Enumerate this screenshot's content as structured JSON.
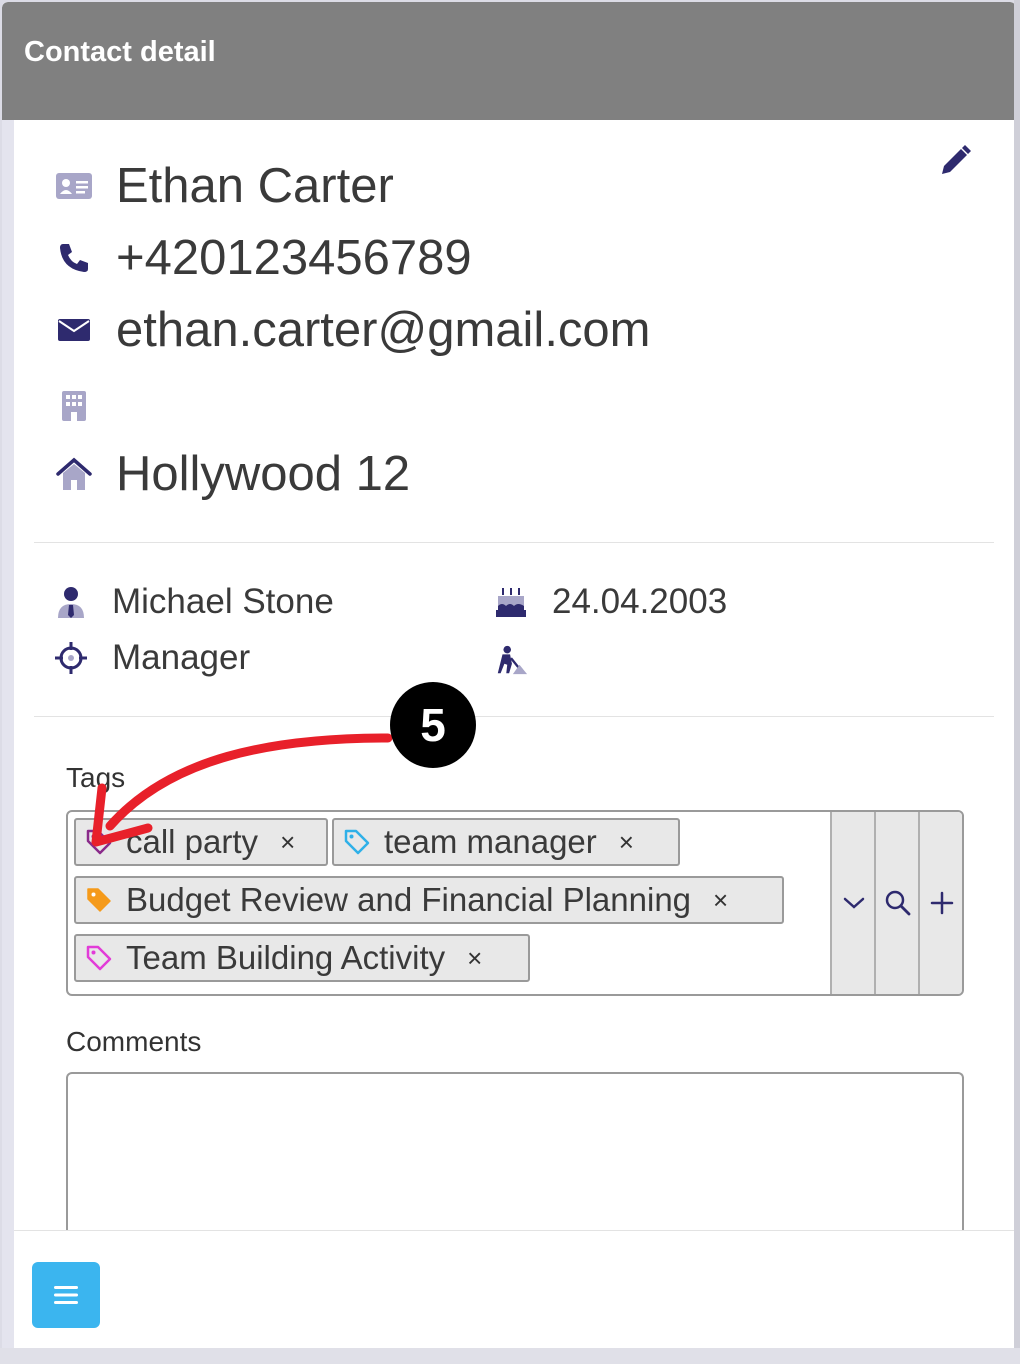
{
  "window": {
    "title": "Contact detail"
  },
  "contact": {
    "name": "Ethan Carter",
    "phone": "+420123456789",
    "email": "ethan.carter@gmail.com",
    "company": "",
    "address": "Hollywood 12"
  },
  "details": {
    "owner": "Michael Stone",
    "birthday": "24.04.2003",
    "position": "Manager",
    "occupation": ""
  },
  "tags": {
    "label": "Tags",
    "items": [
      {
        "text": "call party",
        "color": "#8a2a8a"
      },
      {
        "text": "team manager",
        "color": "#2fb0e8"
      },
      {
        "text": "Budget Review and Financial Planning",
        "color": "#f59a1a"
      },
      {
        "text": "Team Building Activity",
        "color": "#e23cd8"
      }
    ],
    "remove_glyph": "×"
  },
  "comments": {
    "label": "Comments",
    "value": ""
  },
  "annotation": {
    "step": "5",
    "color": "#e8202a"
  },
  "colors": {
    "icon": "#2e2a6e",
    "icon_light": "#a8a6c8",
    "menu": "#3bb5ef",
    "titlebar": "#808080"
  }
}
